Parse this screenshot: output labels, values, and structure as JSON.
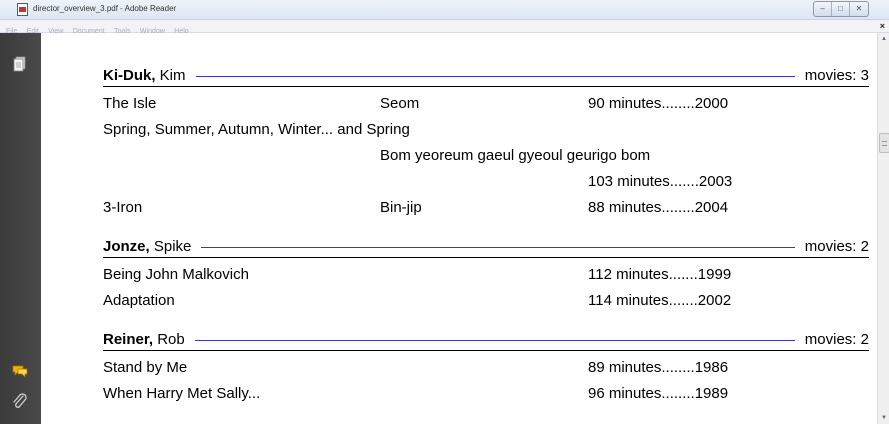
{
  "window": {
    "title": "director_overview_3.pdf - Adobe Reader",
    "controls": {
      "minimize": "–",
      "maximize": "□",
      "close": "✕"
    }
  },
  "menubar": {
    "items": [
      "File",
      "Edit",
      "View",
      "Document",
      "Tools",
      "Window",
      "Help"
    ],
    "doc_close": "×"
  },
  "navpane": {
    "icons": [
      "pages-icon",
      "comments-icon",
      "attachments-icon"
    ],
    "colors": {
      "background": "#404040",
      "comments": "#f0b400"
    }
  },
  "document": {
    "directors": [
      {
        "last": "Ki-Duk,",
        "first": "Kim",
        "count": "movies: 3",
        "movies": [
          {
            "title": "The Isle",
            "orig": "Seom",
            "length": "90 minutes",
            "dots": "........",
            "year": "2000"
          },
          {
            "title": "Spring, Summer, Autumn, Winter... and Spring",
            "orig": "",
            "length": "",
            "dots": "",
            "year": ""
          },
          {
            "title": "",
            "orig": "Bom yeoreum gaeul gyeoul geurigo bom",
            "length": "",
            "dots": "",
            "year": ""
          },
          {
            "title": "",
            "orig": "",
            "length": "103 minutes",
            "dots": ".......",
            "year": "2003"
          },
          {
            "title": "3-Iron",
            "orig": "Bin-jip",
            "length": "88 minutes",
            "dots": "........",
            "year": "2004"
          }
        ]
      },
      {
        "last": "Jonze,",
        "first": "Spike",
        "count": "movies: 2",
        "movies": [
          {
            "title": "Being John Malkovich",
            "orig": "",
            "length": "112 minutes",
            "dots": ".......",
            "year": "1999"
          },
          {
            "title": "Adaptation",
            "orig": "",
            "length": "114 minutes",
            "dots": ".......",
            "year": "2002"
          }
        ]
      },
      {
        "last": "Reiner,",
        "first": "Rob",
        "count": "movies: 2",
        "movies": [
          {
            "title": "Stand by Me",
            "orig": "",
            "length": "89 minutes",
            "dots": "........",
            "year": "1986"
          },
          {
            "title": "When Harry Met Sally...",
            "orig": "",
            "length": "96 minutes",
            "dots": "........",
            "year": "1989"
          }
        ]
      }
    ]
  },
  "colors": {
    "rule": "#3338c8",
    "titlebar": "#dde6f2"
  }
}
